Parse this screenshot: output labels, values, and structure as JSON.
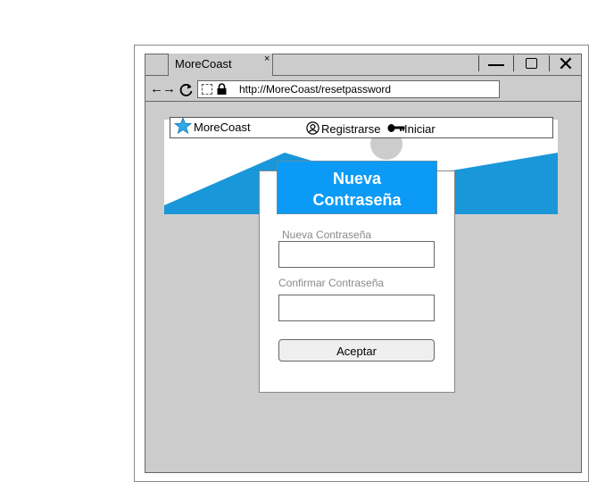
{
  "browser": {
    "tab_title": "MoreCoast",
    "tab_close": "×",
    "nav_arrows": "←→",
    "url": "http://MoreCoast/resetpassword",
    "window_close": "✕"
  },
  "site": {
    "brand": "MoreCoast",
    "register_label": "Registrarse",
    "login_label": "Iniciar",
    "accent_color": "#0b9af5",
    "mountain_color": "#1a97d8",
    "star_color": "#2ea8e8"
  },
  "dialog": {
    "title_line1": "Nueva",
    "title_line2": "Contraseña",
    "new_password_label": "Nueva Contraseña",
    "new_password_value": "",
    "confirm_password_label": "Confirmar Contraseña",
    "confirm_password_value": "",
    "accept_label": "Aceptar"
  }
}
